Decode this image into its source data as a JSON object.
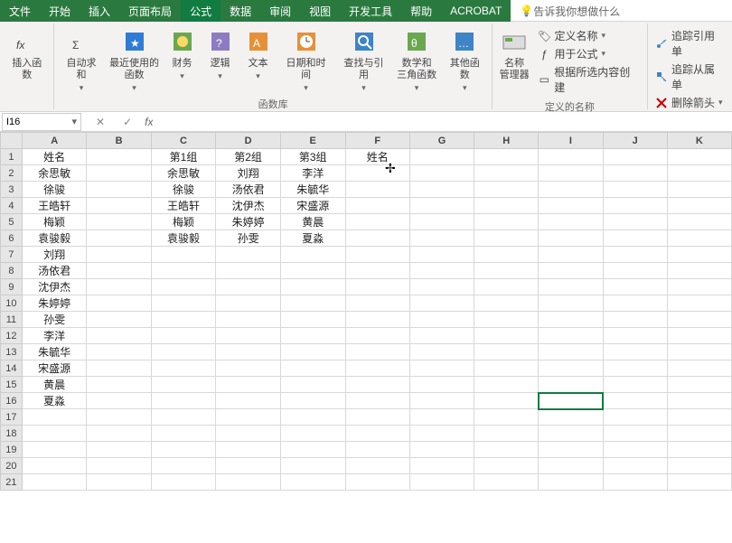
{
  "tabs": {
    "items": [
      "文件",
      "开始",
      "插入",
      "页面布局",
      "公式",
      "数据",
      "审阅",
      "视图",
      "开发工具",
      "帮助",
      "ACROBAT"
    ],
    "tell": "告诉我你想做什么",
    "active": 4
  },
  "ribbon": {
    "g1": {
      "insertfn": "插入函数"
    },
    "g2": {
      "autosum": "自动求和",
      "recent": "最近使用的\n函数",
      "financial": "财务",
      "logical": "逻辑",
      "text": "文本",
      "datetime": "日期和时间",
      "lookup": "查找与引用",
      "math": "数学和\n三角函数",
      "other": "其他函数",
      "label": "函数库"
    },
    "g3": {
      "namemgr": "名称\n管理器",
      "defname": "定义名称",
      "usefml": "用于公式",
      "fromsel": "根据所选内容创建",
      "label": "定义的名称"
    },
    "g4": {
      "traceprec": "追踪引用单",
      "tracedep": "追踪从属单",
      "removearrow": "删除箭头"
    }
  },
  "namebox": {
    "ref": "I16"
  },
  "sheet": {
    "cols": [
      "A",
      "B",
      "C",
      "D",
      "E",
      "F",
      "G",
      "H",
      "I",
      "J",
      "K"
    ],
    "rows": 21,
    "data": {
      "A": [
        "姓名",
        "余思敏",
        "徐骏",
        "王皓轩",
        "梅颖",
        "袁骏毅",
        "刘翔",
        "汤依君",
        "沈伊杰",
        "朱婷婷",
        "孙雯",
        "李洋",
        "朱毓华",
        "宋盛源",
        "黄晨",
        "夏淼"
      ],
      "C": [
        "第1组",
        "余思敏",
        "徐骏",
        "王皓轩",
        "梅颖",
        "袁骏毅"
      ],
      "D": [
        "第2组",
        "刘翔",
        "汤依君",
        "沈伊杰",
        "朱婷婷",
        "孙雯"
      ],
      "E": [
        "第3组",
        "李洋",
        "朱毓华",
        "宋盛源",
        "黄晨",
        "夏淼"
      ],
      "F": [
        "姓名"
      ]
    },
    "selected": {
      "col": "I",
      "row": 16
    }
  }
}
